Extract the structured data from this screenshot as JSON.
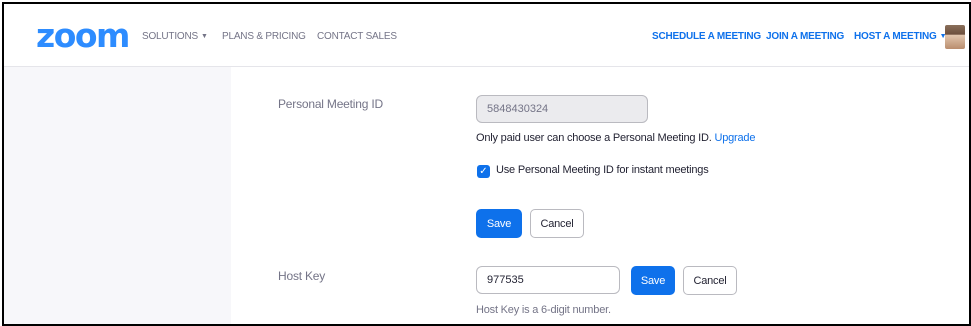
{
  "nav": {
    "logo": "zoom",
    "solutions": "SOLUTIONS",
    "plans_pricing": "PLANS & PRICING",
    "contact_sales": "CONTACT SALES",
    "schedule_meeting": "SCHEDULE A MEETING",
    "join_meeting": "JOIN A MEETING",
    "host_meeting": "HOST A MEETING"
  },
  "pmi": {
    "label": "Personal Meeting ID",
    "value": "5848430324",
    "note": "Only paid user can choose a Personal Meeting ID.",
    "upgrade_link": "Upgrade",
    "checkbox_label": "Use Personal Meeting ID for instant meetings",
    "checkbox_checked": true,
    "save": "Save",
    "cancel": "Cancel"
  },
  "host_key": {
    "label": "Host Key",
    "value": "977535",
    "save": "Save",
    "cancel": "Cancel",
    "hint": "Host Key is a 6-digit number."
  },
  "colors": {
    "brand": "#2d8cff",
    "primary_button": "#0e71eb",
    "sidebar_bg": "#f7f7fa"
  }
}
